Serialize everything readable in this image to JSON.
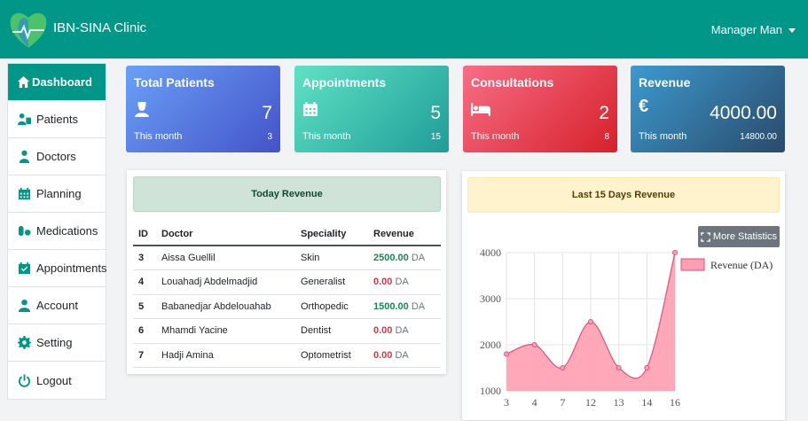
{
  "app": {
    "brand": "IBN-SINA Clinic",
    "user_name": "Manager Man"
  },
  "sidebar": {
    "items": [
      {
        "label": "Dashboard",
        "icon": "home-icon",
        "active": true
      },
      {
        "label": "Patients",
        "icon": "patients-icon"
      },
      {
        "label": "Doctors",
        "icon": "doctor-icon"
      },
      {
        "label": "Planning",
        "icon": "calendar-icon"
      },
      {
        "label": "Medications",
        "icon": "pills-icon"
      },
      {
        "label": "Appointments",
        "icon": "calendar-check-icon"
      },
      {
        "label": "Account",
        "icon": "user-icon"
      },
      {
        "label": "Setting",
        "icon": "gear-icon"
      },
      {
        "label": "Logout",
        "icon": "power-icon"
      }
    ]
  },
  "cards": [
    {
      "title": "Total Patients",
      "value": "7",
      "sub_label": "This month",
      "sub_value": "3",
      "icon": "user-nurse-icon"
    },
    {
      "title": "Appointments",
      "value": "5",
      "sub_label": "This month",
      "sub_value": "15",
      "icon": "calendar-icon"
    },
    {
      "title": "Consultations",
      "value": "2",
      "sub_label": "This month",
      "sub_value": "8",
      "icon": "bed-icon"
    },
    {
      "title": "Revenue",
      "value": "4000.00",
      "sub_label": "This month",
      "sub_value": "14800.00",
      "icon": "euro-icon"
    }
  ],
  "today_revenue": {
    "title": "Today Revenue",
    "columns": [
      "ID",
      "Doctor",
      "Speciality",
      "Revenue"
    ],
    "rows": [
      {
        "id": "3",
        "doctor": "Aissa Guellil",
        "speciality": "Skin",
        "revenue": "2500.00",
        "unit": "DA"
      },
      {
        "id": "4",
        "doctor": "Louahadj Abdelmadjid",
        "speciality": "Generalist",
        "revenue": "0.00",
        "unit": "DA"
      },
      {
        "id": "5",
        "doctor": "Babanedjar Abdelouahab",
        "speciality": "Orthopedic",
        "revenue": "1500.00",
        "unit": "DA"
      },
      {
        "id": "6",
        "doctor": "Mhamdi Yacine",
        "speciality": "Dentist",
        "revenue": "0.00",
        "unit": "DA"
      },
      {
        "id": "7",
        "doctor": "Hadji Amina",
        "speciality": "Optometrist",
        "revenue": "0.00",
        "unit": "DA"
      }
    ]
  },
  "last15": {
    "title": "Last 15 Days Revenue",
    "more_button": "More Statistics"
  },
  "colors": {
    "primary": "#009688",
    "series_fill": "#ff9fb1",
    "series_line": "#d9537a"
  },
  "chart_data": {
    "type": "area",
    "x": [
      "3",
      "4",
      "7",
      "12",
      "13",
      "14",
      "16"
    ],
    "series": [
      {
        "name": "Revenue (DA)",
        "values": [
          1800,
          2000,
          1500,
          2500,
          1500,
          1500,
          4000
        ]
      }
    ],
    "ylim": [
      1000,
      4000
    ],
    "y_ticks": [
      1000,
      2000,
      3000,
      4000
    ],
    "legend": "top-right",
    "grid": true
  }
}
